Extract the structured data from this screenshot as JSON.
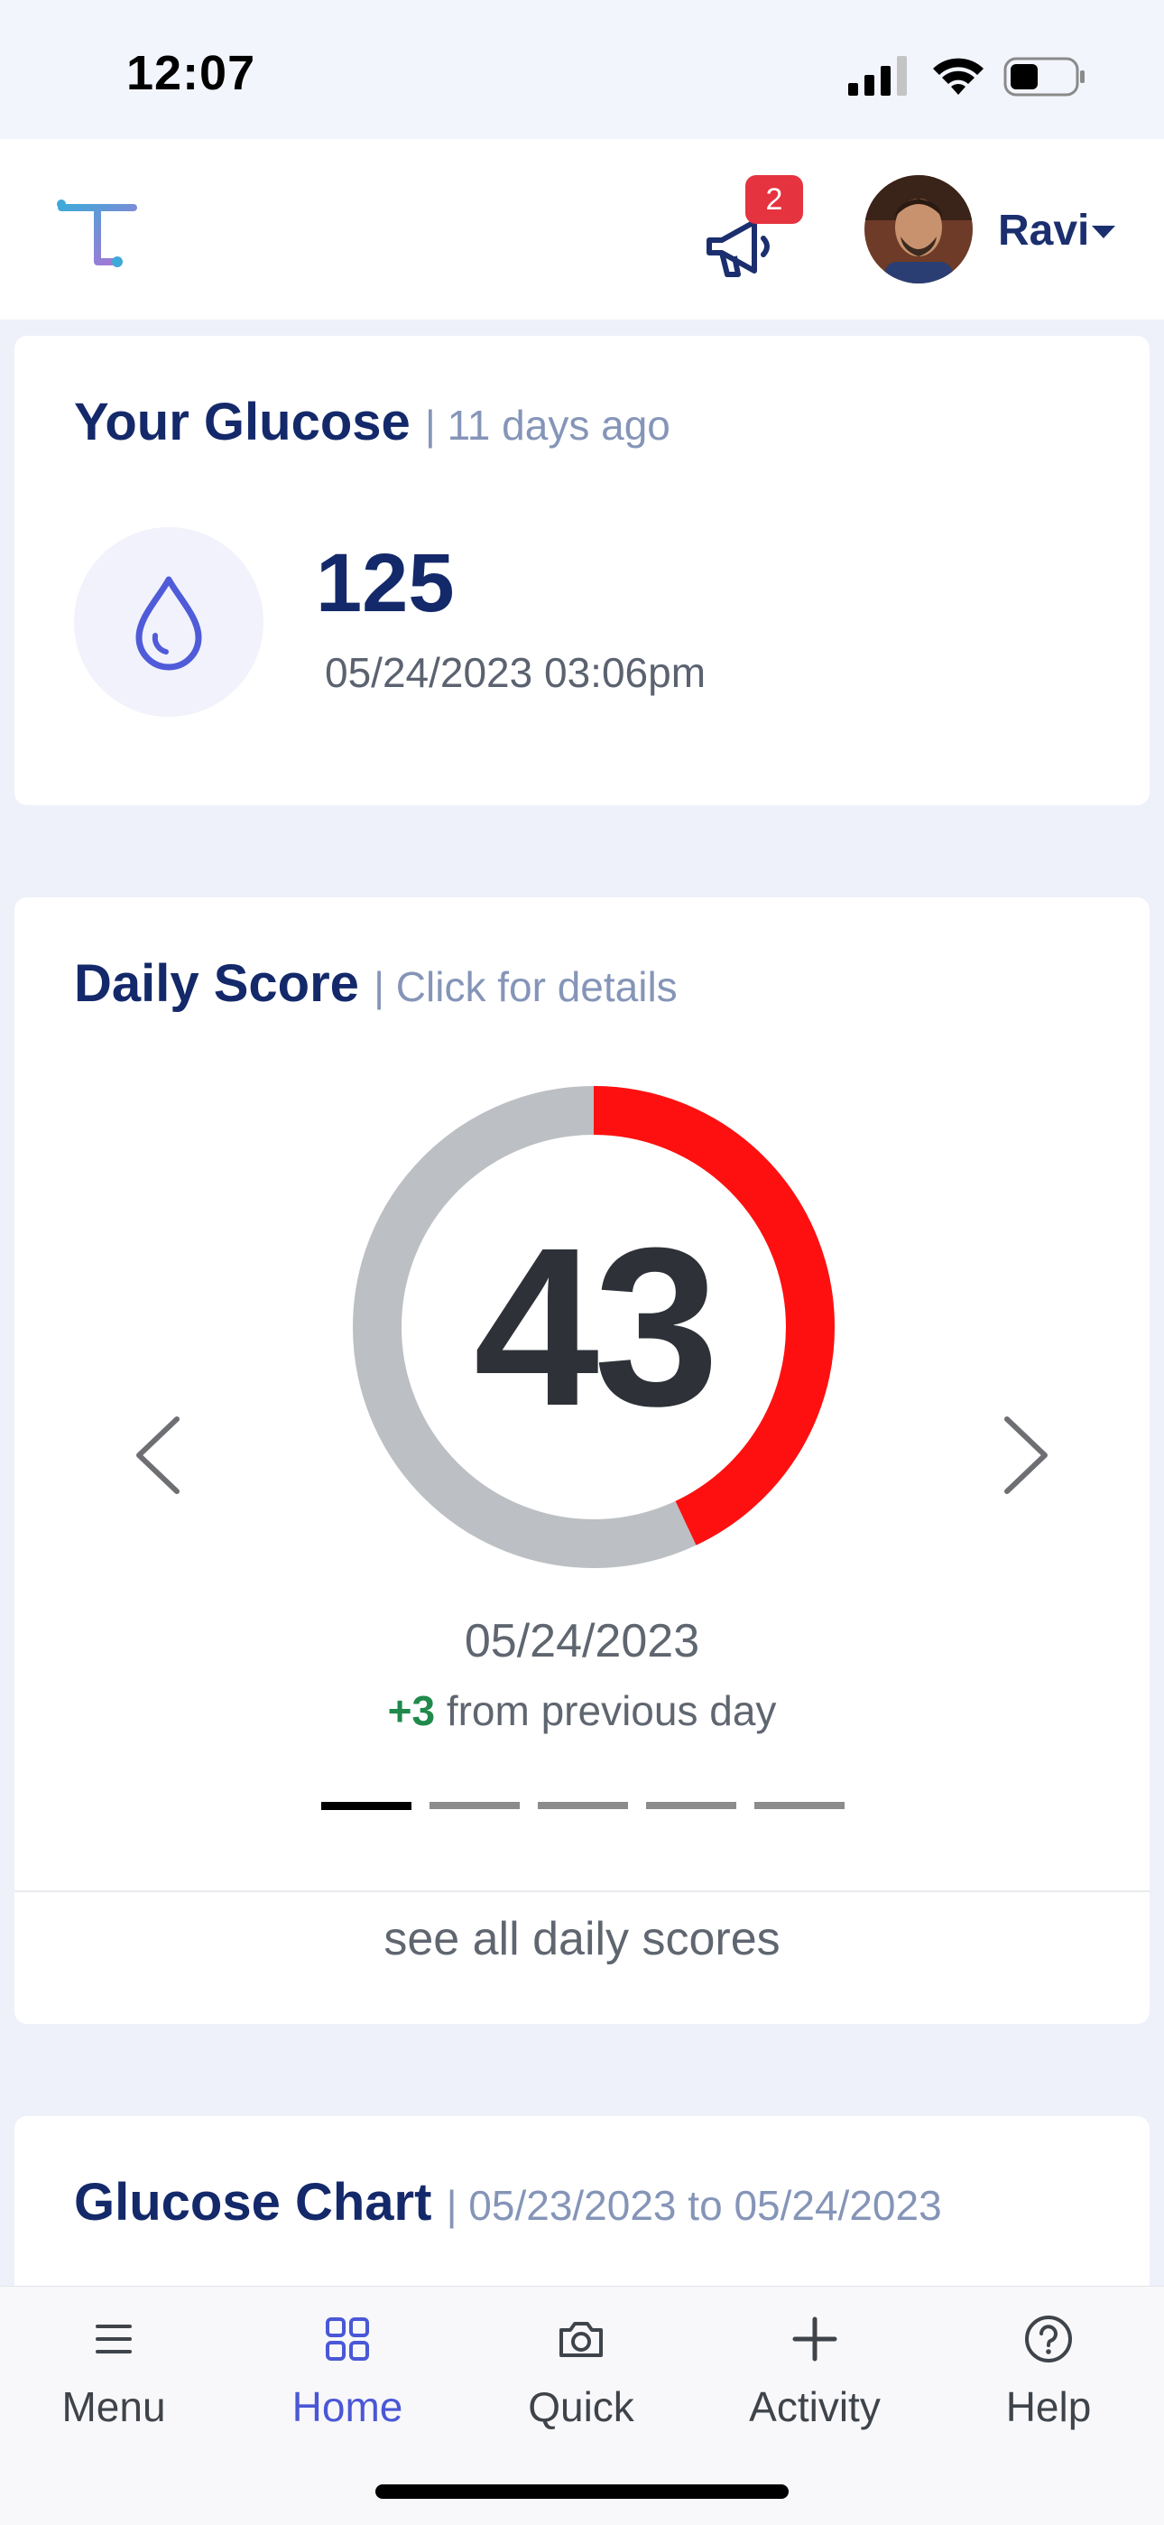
{
  "status_bar": {
    "time": "12:07"
  },
  "header": {
    "notification_count": "2",
    "user_name": "Ravi"
  },
  "glucose": {
    "title": "Your Glucose",
    "subtitle": "| 11 days ago",
    "value": "125",
    "timestamp": "05/24/2023 03:06pm"
  },
  "daily_score": {
    "title": "Daily Score",
    "subtitle": "| Click for details",
    "score": "43",
    "score_fraction": 0.43,
    "date": "05/24/2023",
    "delta": "+3",
    "delta_text": "from previous day",
    "pages_total": 5,
    "page_active": 1,
    "see_all": "see all daily scores"
  },
  "glucose_chart": {
    "title": "Glucose Chart",
    "subtitle": "| 05/23/2023 to 05/24/2023"
  },
  "bottom_nav": {
    "items": [
      {
        "label": "Menu",
        "icon": "menu-icon"
      },
      {
        "label": "Home",
        "icon": "grid-icon"
      },
      {
        "label": "Quick",
        "icon": "camera-icon"
      },
      {
        "label": "Activity",
        "icon": "plus-icon"
      },
      {
        "label": "Help",
        "icon": "help-icon"
      }
    ],
    "active": "Home"
  },
  "colors": {
    "brand_navy": "#14296a",
    "score_red": "#ff1010",
    "ring_gray": "#bcbfc3",
    "delta_green": "#1f8a4c",
    "active_nav": "#4a57d6",
    "badge_red": "#e5333f"
  }
}
